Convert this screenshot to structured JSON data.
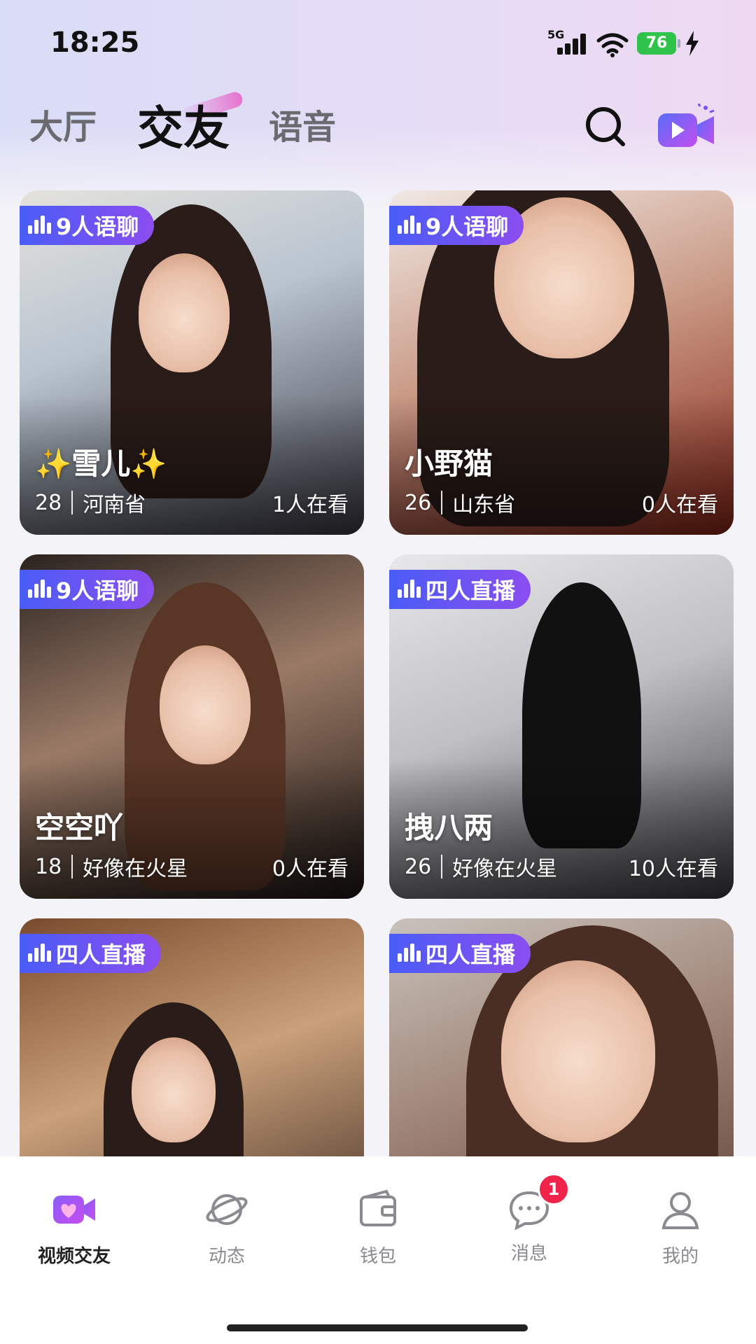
{
  "status_bar": {
    "time": "18:25",
    "network": "5G",
    "battery": "76"
  },
  "tabs": [
    {
      "label": "大厅"
    },
    {
      "label": "交友"
    },
    {
      "label": "语音"
    }
  ],
  "colors": {
    "accent": "#7a52f4",
    "badge": "#f0244a",
    "battery": "#2fc34b"
  },
  "cards": [
    {
      "badge": "9人语聊",
      "name": "✨雪儿✨",
      "age": "28",
      "location": "河南省",
      "viewers": "1人在看"
    },
    {
      "badge": "9人语聊",
      "name": "小野猫",
      "age": "26",
      "location": "山东省",
      "viewers": "0人在看"
    },
    {
      "badge": "9人语聊",
      "name": "空空吖",
      "age": "18",
      "location": "好像在火星",
      "viewers": "0人在看"
    },
    {
      "badge": "四人直播",
      "name": "拽八两",
      "age": "26",
      "location": "好像在火星",
      "viewers": "10人在看"
    },
    {
      "badge": "四人直播",
      "name": "",
      "age": "",
      "location": "",
      "viewers": ""
    },
    {
      "badge": "四人直播",
      "name": "",
      "age": "",
      "location": "",
      "viewers": ""
    }
  ],
  "nav": [
    {
      "label": "视频交友",
      "icon": "video-heart-icon"
    },
    {
      "label": "动态",
      "icon": "planet-icon"
    },
    {
      "label": "钱包",
      "icon": "wallet-icon"
    },
    {
      "label": "消息",
      "icon": "chat-bubble-icon",
      "badge": "1"
    },
    {
      "label": "我的",
      "icon": "person-icon"
    }
  ]
}
